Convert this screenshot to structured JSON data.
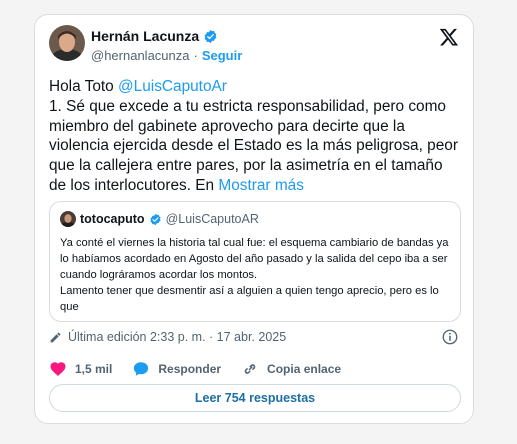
{
  "author": {
    "name": "Hernán Lacunza",
    "handle": "@hernanlacunza",
    "separator": "·",
    "follow_label": "Seguir",
    "verified": true
  },
  "post": {
    "greeting": "Hola Toto ",
    "mention": "@LuisCaputoAr",
    "text": "1. Sé que excede a tu estricta responsabilidad, pero como miembro del gabinete aprovecho para decirte que la violencia ejercida desde el Estado es la más peligrosa, peor que la callejera entre pares, por la asimetría en el tamaño de los interlocutores. En ",
    "show_more": "Mostrar más"
  },
  "quote": {
    "name": "totocaputo",
    "handle": "@LuisCaputoAR",
    "verified": true,
    "text": "Ya conté el viernes la historia tal cual fue: el esquema cambiario de bandas ya lo habíamos acordado en Agosto del año pasado y la salida del cepo iba a ser cuando lográramos acordar los montos.\nLamento tener que desmentir así a alguien a quien tengo aprecio, pero es lo que"
  },
  "edited": "Última edición 2:33 p. m. · 17 abr. 2025",
  "actions": {
    "likes": "1,5 mil",
    "reply_label": "Responder",
    "copy_label": "Copia enlace"
  },
  "read_replies_label": "Leer 754 respuestas",
  "colors": {
    "accent": "#1d9bf0",
    "like": "#f91880",
    "text": "#0f1419",
    "muted": "#536471"
  },
  "icons": [
    "verified-badge-icon",
    "x-logo-icon",
    "pencil-icon",
    "info-icon",
    "heart-icon",
    "comment-icon",
    "link-icon"
  ]
}
